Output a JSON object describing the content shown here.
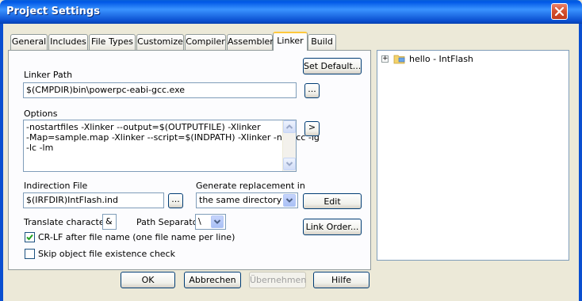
{
  "window": {
    "title": "Project Settings"
  },
  "tabs": [
    {
      "label": "General"
    },
    {
      "label": "Includes"
    },
    {
      "label": "File Types"
    },
    {
      "label": "Customize"
    },
    {
      "label": "Compiler"
    },
    {
      "label": "Assembler"
    },
    {
      "label": "Linker"
    },
    {
      "label": "Build"
    }
  ],
  "active_tab": "Linker",
  "linker": {
    "set_default_label": "Set Default...",
    "linker_path_label": "Linker Path",
    "linker_path_value": "$(CMPDIR)bin\\powerpc-eabi-gcc.exe",
    "browse_label": "...",
    "options_label": "Options",
    "options_lines": [
      "-nostartfiles -Xlinker --output=$(OUTPUTFILE) -Xlinker",
      "-Map=sample.map -Xlinker --script=$(INDPATH) -Xlinker -n -lgcc -lg",
      "-lc -lm"
    ],
    "options_expand_label": ">",
    "indirection_file_label": "Indirection File",
    "indirection_file_value": "$(IRFDIR)IntFlash.ind",
    "generate_replacement_label": "Generate replacement in",
    "generate_replacement_value": "the same directory",
    "edit_label": "Edit",
    "translate_char_label": "Translate character:",
    "translate_char_value": "&",
    "path_separator_label": "Path Separator",
    "path_separator_value": "\\",
    "link_order_label": "Link Order...",
    "crlf_label": "CR-LF after file name (one file name per line)",
    "crlf_checked": true,
    "skip_check_label": "Skip object file existence check",
    "skip_check_checked": false
  },
  "tree": {
    "expander": "+",
    "item_label": "hello - IntFlash"
  },
  "footer": {
    "ok_label": "OK",
    "cancel_label": "Abbrechen",
    "apply_label": "Übernehmen",
    "help_label": "Hilfe"
  }
}
